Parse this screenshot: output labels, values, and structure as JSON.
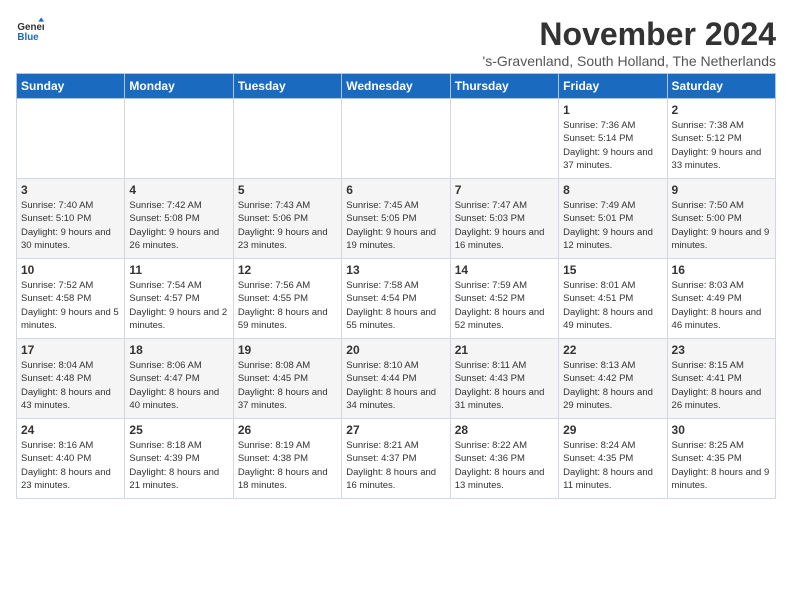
{
  "logo": {
    "line1": "General",
    "line2": "Blue"
  },
  "title": "November 2024",
  "location": "'s-Gravenland, South Holland, The Netherlands",
  "weekdays": [
    "Sunday",
    "Monday",
    "Tuesday",
    "Wednesday",
    "Thursday",
    "Friday",
    "Saturday"
  ],
  "weeks": [
    [
      {
        "day": "",
        "sunrise": "",
        "sunset": "",
        "daylight": ""
      },
      {
        "day": "",
        "sunrise": "",
        "sunset": "",
        "daylight": ""
      },
      {
        "day": "",
        "sunrise": "",
        "sunset": "",
        "daylight": ""
      },
      {
        "day": "",
        "sunrise": "",
        "sunset": "",
        "daylight": ""
      },
      {
        "day": "",
        "sunrise": "",
        "sunset": "",
        "daylight": ""
      },
      {
        "day": "1",
        "sunrise": "Sunrise: 7:36 AM",
        "sunset": "Sunset: 5:14 PM",
        "daylight": "Daylight: 9 hours and 37 minutes."
      },
      {
        "day": "2",
        "sunrise": "Sunrise: 7:38 AM",
        "sunset": "Sunset: 5:12 PM",
        "daylight": "Daylight: 9 hours and 33 minutes."
      }
    ],
    [
      {
        "day": "3",
        "sunrise": "Sunrise: 7:40 AM",
        "sunset": "Sunset: 5:10 PM",
        "daylight": "Daylight: 9 hours and 30 minutes."
      },
      {
        "day": "4",
        "sunrise": "Sunrise: 7:42 AM",
        "sunset": "Sunset: 5:08 PM",
        "daylight": "Daylight: 9 hours and 26 minutes."
      },
      {
        "day": "5",
        "sunrise": "Sunrise: 7:43 AM",
        "sunset": "Sunset: 5:06 PM",
        "daylight": "Daylight: 9 hours and 23 minutes."
      },
      {
        "day": "6",
        "sunrise": "Sunrise: 7:45 AM",
        "sunset": "Sunset: 5:05 PM",
        "daylight": "Daylight: 9 hours and 19 minutes."
      },
      {
        "day": "7",
        "sunrise": "Sunrise: 7:47 AM",
        "sunset": "Sunset: 5:03 PM",
        "daylight": "Daylight: 9 hours and 16 minutes."
      },
      {
        "day": "8",
        "sunrise": "Sunrise: 7:49 AM",
        "sunset": "Sunset: 5:01 PM",
        "daylight": "Daylight: 9 hours and 12 minutes."
      },
      {
        "day": "9",
        "sunrise": "Sunrise: 7:50 AM",
        "sunset": "Sunset: 5:00 PM",
        "daylight": "Daylight: 9 hours and 9 minutes."
      }
    ],
    [
      {
        "day": "10",
        "sunrise": "Sunrise: 7:52 AM",
        "sunset": "Sunset: 4:58 PM",
        "daylight": "Daylight: 9 hours and 5 minutes."
      },
      {
        "day": "11",
        "sunrise": "Sunrise: 7:54 AM",
        "sunset": "Sunset: 4:57 PM",
        "daylight": "Daylight: 9 hours and 2 minutes."
      },
      {
        "day": "12",
        "sunrise": "Sunrise: 7:56 AM",
        "sunset": "Sunset: 4:55 PM",
        "daylight": "Daylight: 8 hours and 59 minutes."
      },
      {
        "day": "13",
        "sunrise": "Sunrise: 7:58 AM",
        "sunset": "Sunset: 4:54 PM",
        "daylight": "Daylight: 8 hours and 55 minutes."
      },
      {
        "day": "14",
        "sunrise": "Sunrise: 7:59 AM",
        "sunset": "Sunset: 4:52 PM",
        "daylight": "Daylight: 8 hours and 52 minutes."
      },
      {
        "day": "15",
        "sunrise": "Sunrise: 8:01 AM",
        "sunset": "Sunset: 4:51 PM",
        "daylight": "Daylight: 8 hours and 49 minutes."
      },
      {
        "day": "16",
        "sunrise": "Sunrise: 8:03 AM",
        "sunset": "Sunset: 4:49 PM",
        "daylight": "Daylight: 8 hours and 46 minutes."
      }
    ],
    [
      {
        "day": "17",
        "sunrise": "Sunrise: 8:04 AM",
        "sunset": "Sunset: 4:48 PM",
        "daylight": "Daylight: 8 hours and 43 minutes."
      },
      {
        "day": "18",
        "sunrise": "Sunrise: 8:06 AM",
        "sunset": "Sunset: 4:47 PM",
        "daylight": "Daylight: 8 hours and 40 minutes."
      },
      {
        "day": "19",
        "sunrise": "Sunrise: 8:08 AM",
        "sunset": "Sunset: 4:45 PM",
        "daylight": "Daylight: 8 hours and 37 minutes."
      },
      {
        "day": "20",
        "sunrise": "Sunrise: 8:10 AM",
        "sunset": "Sunset: 4:44 PM",
        "daylight": "Daylight: 8 hours and 34 minutes."
      },
      {
        "day": "21",
        "sunrise": "Sunrise: 8:11 AM",
        "sunset": "Sunset: 4:43 PM",
        "daylight": "Daylight: 8 hours and 31 minutes."
      },
      {
        "day": "22",
        "sunrise": "Sunrise: 8:13 AM",
        "sunset": "Sunset: 4:42 PM",
        "daylight": "Daylight: 8 hours and 29 minutes."
      },
      {
        "day": "23",
        "sunrise": "Sunrise: 8:15 AM",
        "sunset": "Sunset: 4:41 PM",
        "daylight": "Daylight: 8 hours and 26 minutes."
      }
    ],
    [
      {
        "day": "24",
        "sunrise": "Sunrise: 8:16 AM",
        "sunset": "Sunset: 4:40 PM",
        "daylight": "Daylight: 8 hours and 23 minutes."
      },
      {
        "day": "25",
        "sunrise": "Sunrise: 8:18 AM",
        "sunset": "Sunset: 4:39 PM",
        "daylight": "Daylight: 8 hours and 21 minutes."
      },
      {
        "day": "26",
        "sunrise": "Sunrise: 8:19 AM",
        "sunset": "Sunset: 4:38 PM",
        "daylight": "Daylight: 8 hours and 18 minutes."
      },
      {
        "day": "27",
        "sunrise": "Sunrise: 8:21 AM",
        "sunset": "Sunset: 4:37 PM",
        "daylight": "Daylight: 8 hours and 16 minutes."
      },
      {
        "day": "28",
        "sunrise": "Sunrise: 8:22 AM",
        "sunset": "Sunset: 4:36 PM",
        "daylight": "Daylight: 8 hours and 13 minutes."
      },
      {
        "day": "29",
        "sunrise": "Sunrise: 8:24 AM",
        "sunset": "Sunset: 4:35 PM",
        "daylight": "Daylight: 8 hours and 11 minutes."
      },
      {
        "day": "30",
        "sunrise": "Sunrise: 8:25 AM",
        "sunset": "Sunset: 4:35 PM",
        "daylight": "Daylight: 8 hours and 9 minutes."
      }
    ]
  ]
}
